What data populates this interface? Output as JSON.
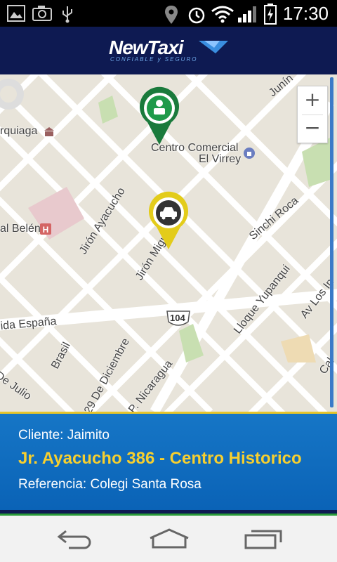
{
  "status_bar": {
    "time": "17:30",
    "icons": [
      "image-icon",
      "camera-icon",
      "usb-icon",
      "location-icon",
      "alarm-icon",
      "wifi-icon",
      "signal-icon",
      "battery-charging-icon"
    ]
  },
  "app_bar": {
    "logo_text": "NewTaxi",
    "logo_tagline": "CONFIABLE y SEGURO"
  },
  "map": {
    "labels": {
      "centro_comercial_1": "Centro Comercial",
      "centro_comercial_2": "El Virrey",
      "quiaga": "rquiaga",
      "belen": "al Belén",
      "jiron_ayacucho": "Jirón Ayacucho",
      "jiron_mig": "Jirón Migu",
      "junin": "Junín",
      "sinchi_roca": "Sinchi Roca",
      "lloque_yupanqui": "Lloque Yupanqui",
      "av_los": "Av Los In",
      "espana": "ida España",
      "brasil": "Brasil",
      "diciembre": "29 De Diciembre",
      "nicaragua": "P. Nicaragua",
      "julio": "De Julio",
      "cal": "Cal",
      "route": "104"
    },
    "zoom_in": "+",
    "zoom_out": "−"
  },
  "info_panel": {
    "client": "Cliente: Jaimito",
    "address": "Jr. Ayacucho 386 - Centro Historico",
    "reference": "Referencia: Colegi Santa Rosa"
  },
  "nav": {
    "icons": [
      "back-icon",
      "home-icon",
      "recent-apps-icon"
    ]
  }
}
